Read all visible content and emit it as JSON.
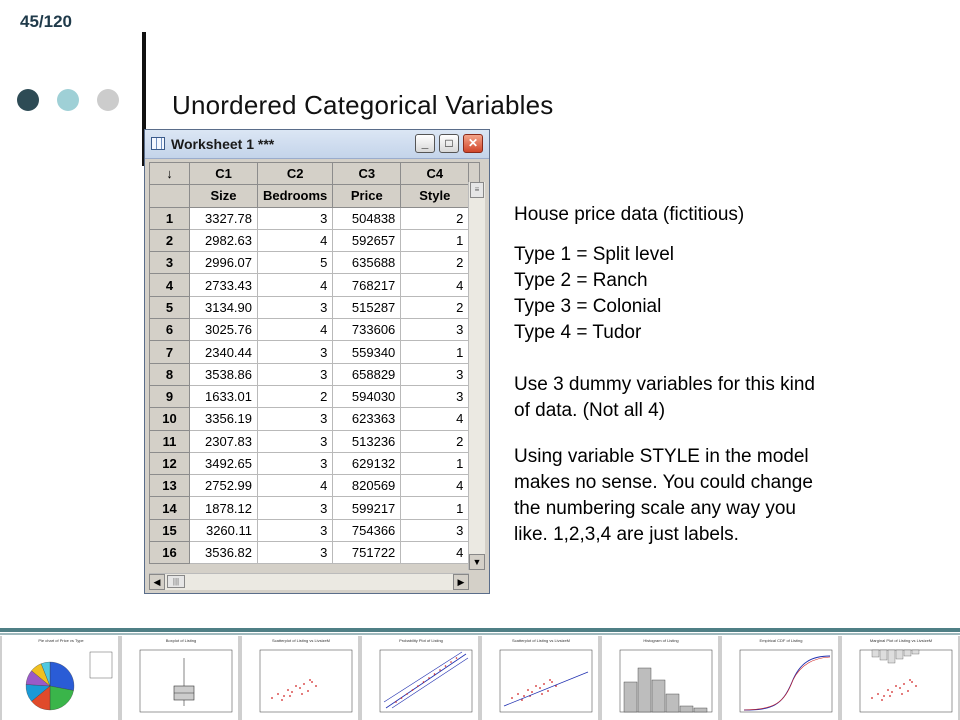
{
  "slide": {
    "number": "45/120",
    "title": "Unordered Categorical Variables",
    "dots": [
      "#2e4b55",
      "#9fd0d6",
      "#cccccc"
    ]
  },
  "worksheet": {
    "title": "Worksheet 1 ***",
    "buttons": {
      "minimize": "_",
      "maximize": "□",
      "close": "✕"
    },
    "corner": "↓",
    "col_ids": [
      "C1",
      "C2",
      "C3",
      "C4"
    ],
    "col_names": [
      "Size",
      "Bedrooms",
      "Price",
      "Style"
    ],
    "rows": [
      {
        "n": "1",
        "size": "3327.78",
        "bed": "3",
        "price": "504838",
        "style": "2"
      },
      {
        "n": "2",
        "size": "2982.63",
        "bed": "4",
        "price": "592657",
        "style": "1"
      },
      {
        "n": "3",
        "size": "2996.07",
        "bed": "5",
        "price": "635688",
        "style": "2"
      },
      {
        "n": "4",
        "size": "2733.43",
        "bed": "4",
        "price": "768217",
        "style": "4"
      },
      {
        "n": "5",
        "size": "3134.90",
        "bed": "3",
        "price": "515287",
        "style": "2"
      },
      {
        "n": "6",
        "size": "3025.76",
        "bed": "4",
        "price": "733606",
        "style": "3"
      },
      {
        "n": "7",
        "size": "2340.44",
        "bed": "3",
        "price": "559340",
        "style": "1"
      },
      {
        "n": "8",
        "size": "3538.86",
        "bed": "3",
        "price": "658829",
        "style": "3"
      },
      {
        "n": "9",
        "size": "1633.01",
        "bed": "2",
        "price": "594030",
        "style": "3"
      },
      {
        "n": "10",
        "size": "3356.19",
        "bed": "3",
        "price": "623363",
        "style": "4"
      },
      {
        "n": "11",
        "size": "2307.83",
        "bed": "3",
        "price": "513236",
        "style": "2"
      },
      {
        "n": "12",
        "size": "3492.65",
        "bed": "3",
        "price": "629132",
        "style": "1"
      },
      {
        "n": "13",
        "size": "2752.99",
        "bed": "4",
        "price": "820569",
        "style": "4"
      },
      {
        "n": "14",
        "size": "1878.12",
        "bed": "3",
        "price": "599217",
        "style": "1"
      },
      {
        "n": "15",
        "size": "3260.11",
        "bed": "3",
        "price": "754366",
        "style": "3"
      },
      {
        "n": "16",
        "size": "3536.82",
        "bed": "3",
        "price": "751722",
        "style": "4"
      }
    ]
  },
  "text": {
    "heading": "House price data (fictitious)",
    "types": [
      "Type 1 = Split level",
      "Type 2 = Ranch",
      "Type 3 = Colonial",
      "Type 4 = Tudor"
    ],
    "dummy": [
      "Use 3 dummy variables for this kind",
      "of data.  (Not all 4)"
    ],
    "style_note": [
      "Using variable STYLE in the model",
      "makes no sense. You could change",
      "the numbering scale any way you",
      "like. 1,2,3,4 are just labels."
    ]
  },
  "thumbnails": [
    {
      "kind": "pie",
      "title": "Pie chart of Price vs Type"
    },
    {
      "kind": "box",
      "title": "Boxplot of Listing"
    },
    {
      "kind": "scatter",
      "title": "Scatterplot of Listing vs LivsizeM"
    },
    {
      "kind": "prob",
      "title": "Probability Plot of Listing"
    },
    {
      "kind": "scatterline",
      "title": "Scatterplot of Listing vs LivsizeM"
    },
    {
      "kind": "hist",
      "title": "Histogram of Listing"
    },
    {
      "kind": "ecdf",
      "title": "Empirical CDF of Listing"
    },
    {
      "kind": "marginal",
      "title": "Marginal Plot of Listing vs LivsizeM"
    }
  ]
}
